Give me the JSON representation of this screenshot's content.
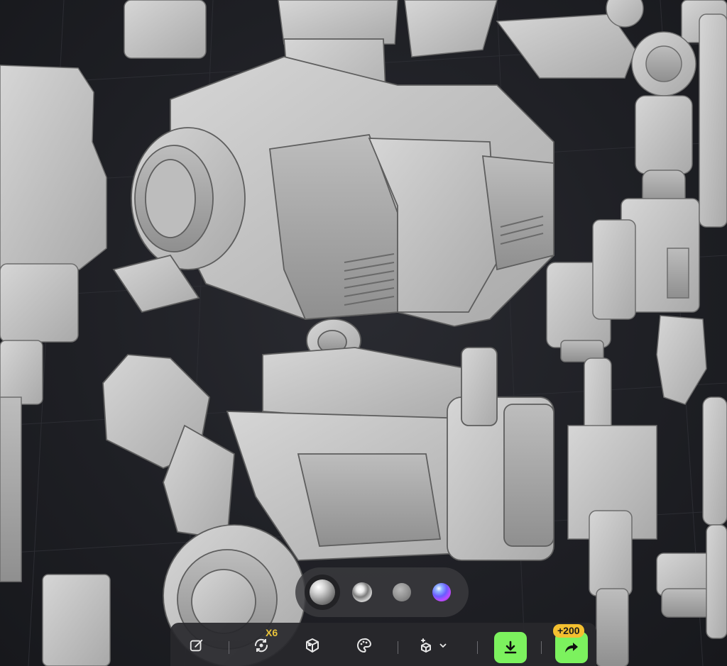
{
  "viewport": {
    "description_icon": "3d-model-viewer",
    "background_color": "#1e1f24",
    "model_color": "#c4c4c4"
  },
  "material_bar": {
    "options": [
      {
        "name": "clay",
        "selected": true
      },
      {
        "name": "chrome",
        "selected": false
      },
      {
        "name": "matte",
        "selected": false
      },
      {
        "name": "iridescent",
        "selected": false
      }
    ]
  },
  "toolbar": {
    "items": [
      {
        "icon": "edit-icon"
      },
      {
        "icon": "rotate-view-icon"
      },
      {
        "icon": "cube-parts-icon"
      },
      {
        "icon": "palette-icon"
      },
      {
        "icon": "scene-options-icon",
        "has_dropdown": true
      },
      {
        "icon": "download-icon"
      },
      {
        "icon": "share-icon"
      }
    ],
    "rotate_badge": "X6",
    "share_badge": "+200",
    "accent_color": "#7cf25e",
    "badge_color": "#f4c030"
  }
}
